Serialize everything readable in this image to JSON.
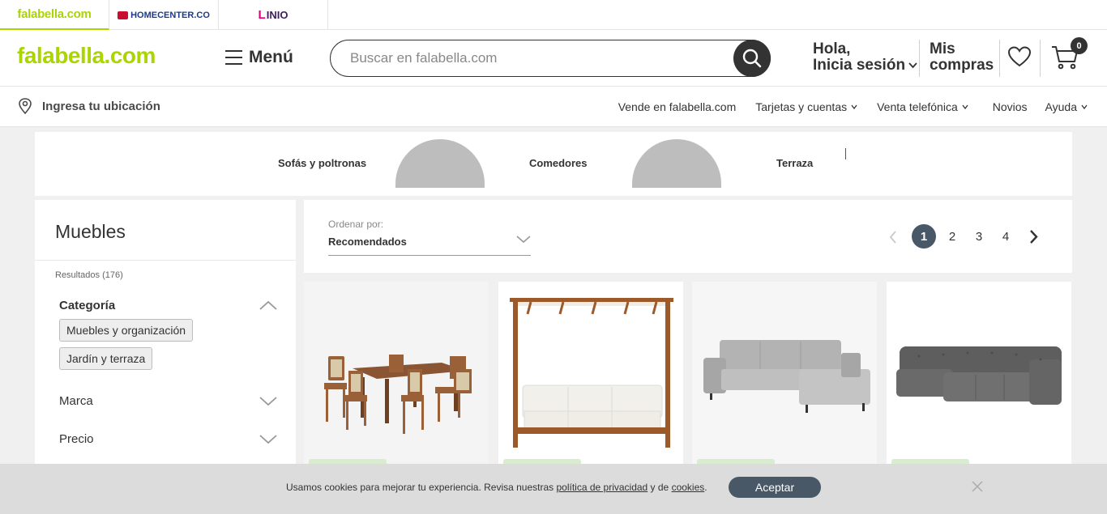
{
  "brand_tabs": [
    {
      "label": "falabella.com"
    },
    {
      "label": "HOMECENTER.CO"
    },
    {
      "label": "INIO"
    }
  ],
  "header": {
    "logo": "falabella.com",
    "menu_label": "Menú",
    "search_placeholder": "Buscar en falabella.com",
    "login_line1": "Hola,",
    "login_line2": "Inicia sesión",
    "purchases_line1": "Mis",
    "purchases_line2": "compras",
    "cart_count": "0"
  },
  "location": {
    "label": "Ingresa tu ubicación"
  },
  "top_links": [
    {
      "label": "Vende en falabella.com",
      "has_dropdown": false
    },
    {
      "label": "Tarjetas y cuentas",
      "has_dropdown": true
    },
    {
      "label": "Venta telefónica",
      "has_dropdown": true
    },
    {
      "label": "Novios",
      "has_dropdown": false
    },
    {
      "label": "Ayuda",
      "has_dropdown": true
    }
  ],
  "categories": [
    "Sofás y poltronas",
    "Comedores",
    "Terraza"
  ],
  "sidebar": {
    "title": "Muebles",
    "results": "Resultados (176)",
    "facets": [
      {
        "label": "Categoría",
        "expanded": true,
        "chips": [
          "Muebles y organización",
          "Jardín y terraza"
        ]
      },
      {
        "label": "Marca",
        "expanded": false
      },
      {
        "label": "Precio",
        "expanded": false
      }
    ]
  },
  "sort": {
    "label": "Ordenar por:",
    "value": "Recomendados"
  },
  "pagination": {
    "pages": [
      "1",
      "2",
      "3",
      "4"
    ],
    "current": "1"
  },
  "products": [
    {
      "image": "dining-table-set-icon"
    },
    {
      "image": "canopy-sofa-icon"
    },
    {
      "image": "sectional-sofa-light-icon"
    },
    {
      "image": "sectional-sofa-dark-icon"
    }
  ],
  "cookie": {
    "text_before": "Usamos cookies para mejorar tu experiencia. Revisa nuestras ",
    "privacy_link": "política de privacidad",
    "text_middle": " y de ",
    "cookies_link": "cookies",
    "text_after": ".",
    "accept": "Aceptar"
  },
  "colors": {
    "brand_green": "#aad500",
    "dark_button": "#495867",
    "text": "#333333"
  }
}
